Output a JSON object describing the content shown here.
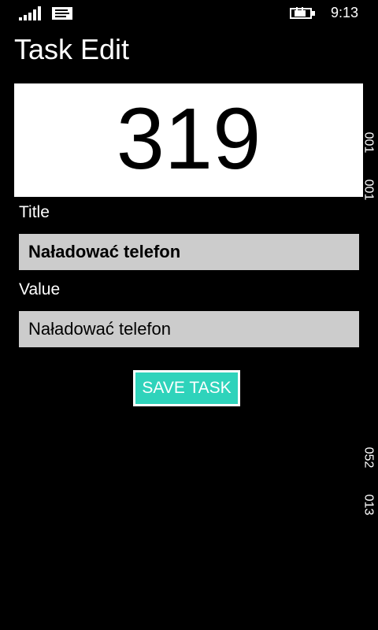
{
  "status_bar": {
    "time": "9:13"
  },
  "page": {
    "title": "Task Edit"
  },
  "task": {
    "value_display": "319",
    "title_label": "Title",
    "title_value": "Naładować telefon",
    "value_label": "Value",
    "value_value": "Naładować telefon",
    "save_label": "SAVE TASK"
  },
  "debug_overlay": [
    "001",
    "001",
    "052",
    "013"
  ],
  "colors": {
    "accent": "#2fd3bb",
    "field_bg": "#cccccc",
    "background": "#000000"
  },
  "icons": [
    "signal-strength-icon",
    "message-icon",
    "battery-charging-icon"
  ]
}
